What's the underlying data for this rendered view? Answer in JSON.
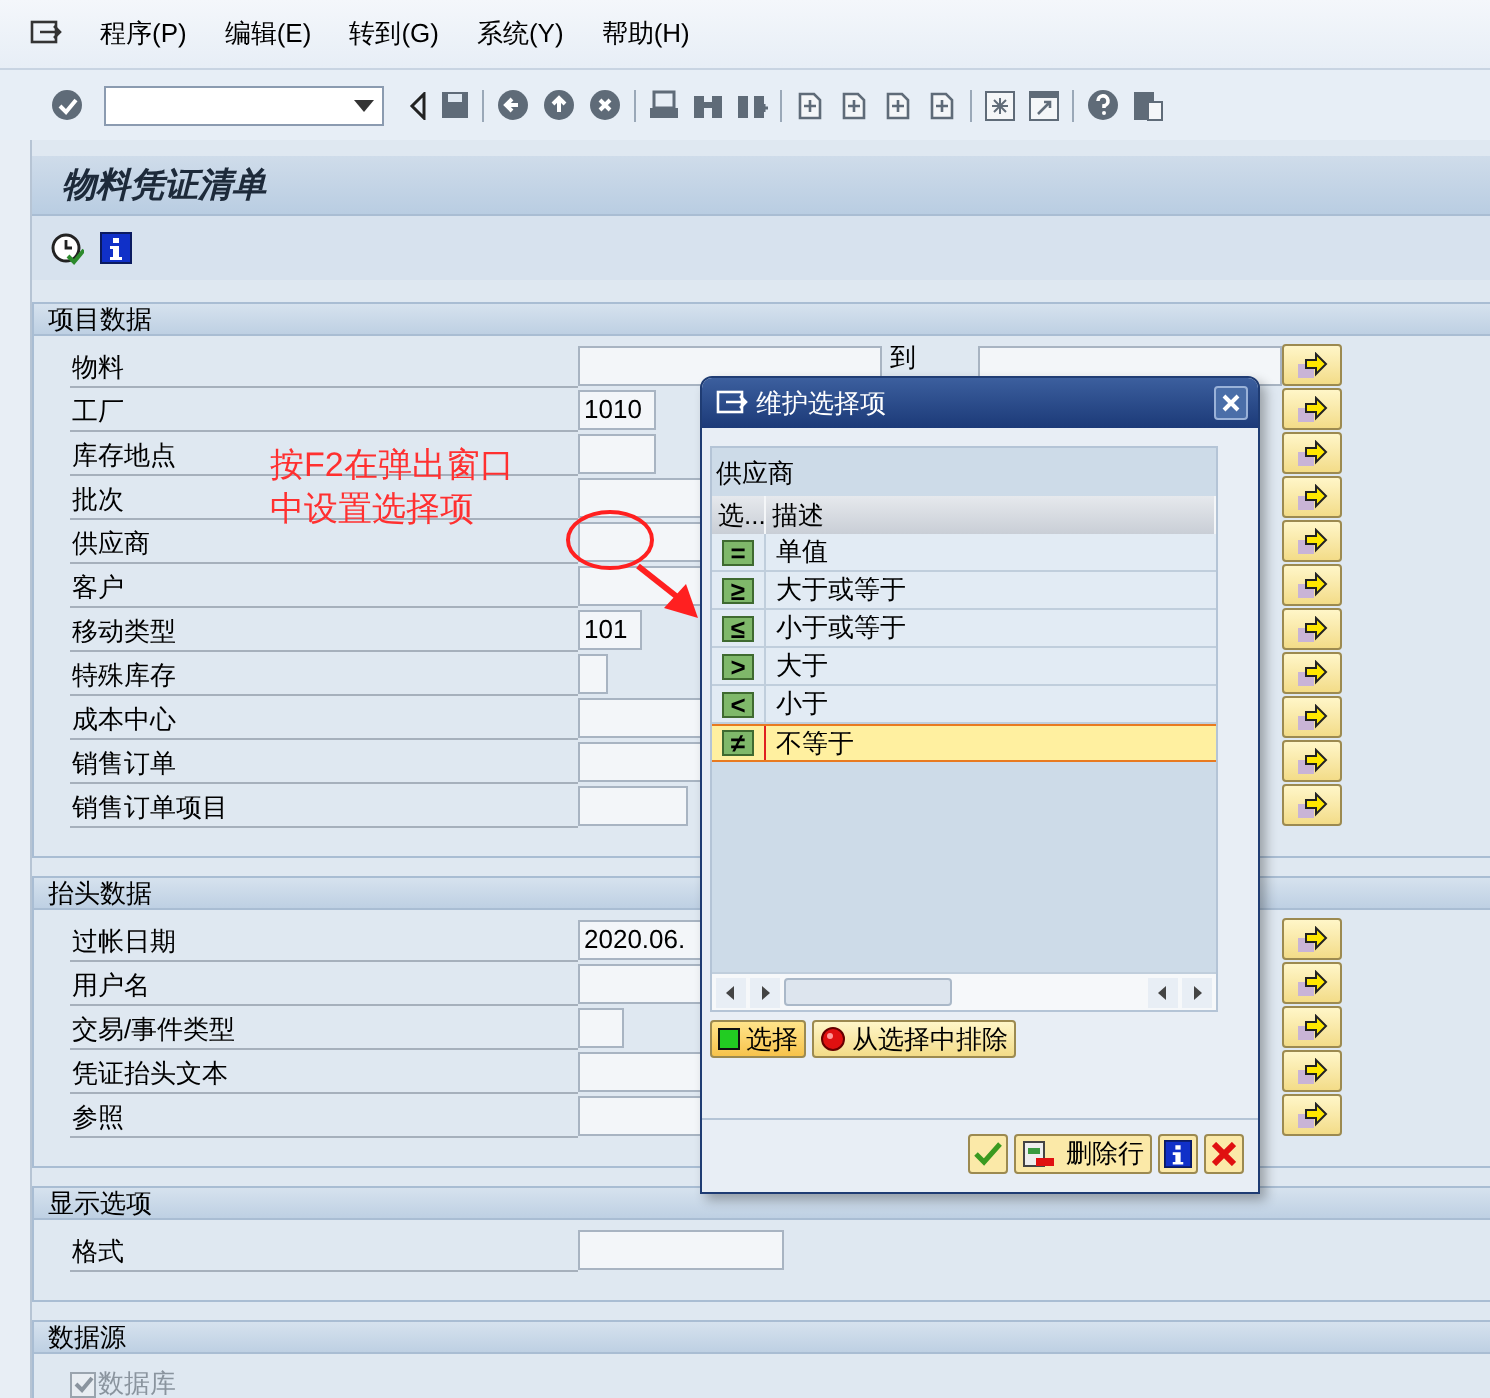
{
  "menu": {
    "items": [
      "程序(P)",
      "编辑(E)",
      "转到(G)",
      "系统(Y)",
      "帮助(H)"
    ]
  },
  "screen_title": "物料凭证清单",
  "sections": [
    {
      "title": "项目数据",
      "rows": [
        {
          "label": "物料",
          "kind": "wide",
          "value": "",
          "to_label": "到",
          "range_button": true
        },
        {
          "label": "工厂",
          "kind": "medium",
          "value": "1010",
          "range_button": true
        },
        {
          "label": "库存地点",
          "kind": "medium",
          "value": "",
          "range_button": true
        },
        {
          "label": "批次",
          "kind": "wide",
          "value": "",
          "range_button": true
        },
        {
          "label": "供应商",
          "kind": "wide",
          "value": "",
          "range_button": true
        },
        {
          "label": "客户",
          "kind": "wide",
          "value": "",
          "range_button": true
        },
        {
          "label": "移动类型",
          "kind": "short",
          "value": "101",
          "range_button": true
        },
        {
          "label": "特殊库存",
          "kind": "tiny",
          "value": "",
          "range_button": true
        },
        {
          "label": "成本中心",
          "kind": "wide",
          "value": "",
          "range_button": true
        },
        {
          "label": "销售订单",
          "kind": "wide",
          "value": "",
          "range_button": true
        },
        {
          "label": "销售订单项目",
          "kind": "long",
          "value": "",
          "range_button": true
        }
      ]
    },
    {
      "title": "抬头数据",
      "rows": [
        {
          "label": "过帐日期",
          "kind": "wide",
          "value": "2020.06.",
          "range_button": true
        },
        {
          "label": "用户名",
          "kind": "wide",
          "value": "",
          "range_button": true
        },
        {
          "label": "交易/事件类型",
          "kind": "small",
          "value": "",
          "range_button": true
        },
        {
          "label": "凭证抬头文本",
          "kind": "wide",
          "value": "",
          "range_button": true
        },
        {
          "label": "参照",
          "kind": "wide",
          "value": "",
          "range_button": true
        }
      ]
    },
    {
      "title": "显示选项",
      "rows": [
        {
          "label": "格式",
          "kind": "large",
          "value": "",
          "range_button": false
        }
      ]
    },
    {
      "title": "数据源",
      "checkbox": {
        "label": "数据库",
        "checked": true,
        "disabled": true
      }
    }
  ],
  "annotation": {
    "lines": [
      "按F2在弹出窗口",
      "中设置选择项"
    ]
  },
  "popup": {
    "title": "维护选择项",
    "table_title": "供应商",
    "columns": [
      "选...",
      "描述"
    ],
    "rows": [
      {
        "symbol": "=",
        "label": "单值",
        "selected": false
      },
      {
        "symbol": "≥",
        "label": "大于或等于",
        "selected": false
      },
      {
        "symbol": "≤",
        "label": "小于或等于",
        "selected": false
      },
      {
        "symbol": ">",
        "label": "大于",
        "selected": false
      },
      {
        "symbol": "<",
        "label": "小于",
        "selected": false
      },
      {
        "symbol": "≠",
        "label": "不等于",
        "selected": true
      }
    ],
    "buttons": [
      {
        "kind": "include",
        "label": "选择"
      },
      {
        "kind": "exclude",
        "label": "从选择中排除"
      }
    ],
    "footer_buttons": [
      {
        "kind": "confirm"
      },
      {
        "kind": "delete",
        "label": "删除行"
      },
      {
        "kind": "info"
      },
      {
        "kind": "cancel"
      }
    ]
  }
}
